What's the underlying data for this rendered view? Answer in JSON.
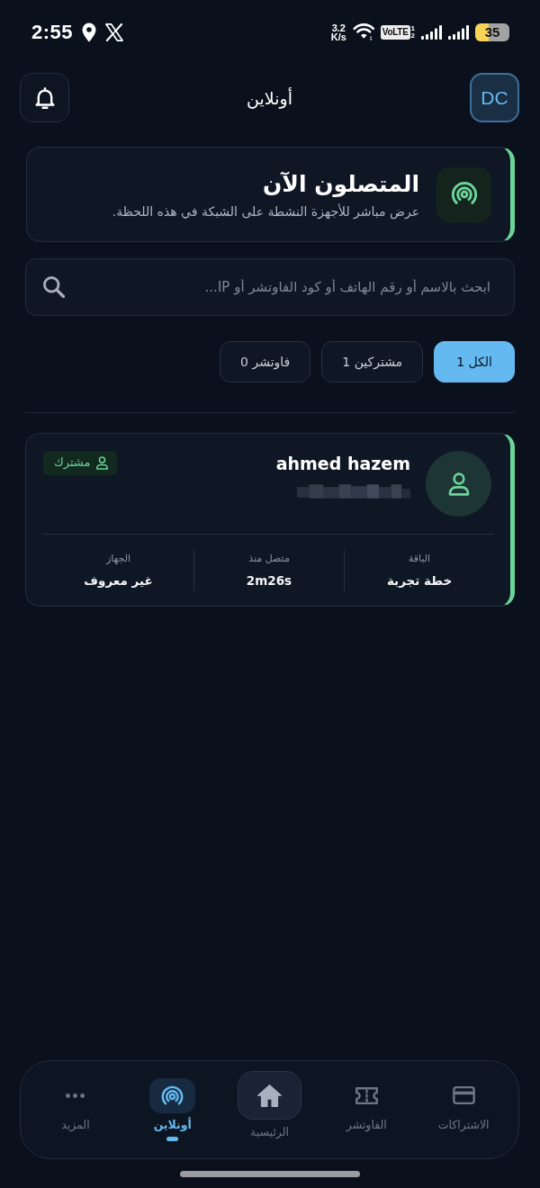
{
  "status_bar": {
    "time": "2:55",
    "net_speed_value": "3.2",
    "net_speed_unit": "K/s",
    "volte": "VoLTE",
    "sim_numbers": [
      "1",
      "2"
    ],
    "battery": "35"
  },
  "header": {
    "avatar_initials": "DC",
    "title": "أونلاين"
  },
  "hero": {
    "title": "المتصلون الآن",
    "subtitle": "عرض مباشر للأجهزة النشطة على الشبكة في هذه اللحظة."
  },
  "search": {
    "placeholder": "ابحث بالاسم أو رقم الهاتف أو كود الفاوتشر أو IP..."
  },
  "filters": [
    {
      "label": "الكل 1",
      "selected": true
    },
    {
      "label": "مشتركين 1",
      "selected": false
    },
    {
      "label": "فاوتشر 0",
      "selected": false
    }
  ],
  "sessions": [
    {
      "name": "ahmed hazem",
      "badge": "مشترك",
      "fields": [
        {
          "label": "الباقة",
          "value": "خطة تجربة"
        },
        {
          "label": "متصل منذ",
          "value": "2m26s"
        },
        {
          "label": "الجهاز",
          "value": "غير معروف"
        }
      ]
    }
  ],
  "bottom_nav": [
    {
      "label": "الاشتراكات",
      "kind": "tab",
      "selected": false
    },
    {
      "label": "الفاوتشر",
      "kind": "tab",
      "selected": false
    },
    {
      "label": "الرئيسية",
      "kind": "center",
      "selected": false
    },
    {
      "label": "أونلاين",
      "kind": "tab",
      "selected": true
    },
    {
      "label": "المزيد",
      "kind": "tab",
      "selected": false
    }
  ]
}
